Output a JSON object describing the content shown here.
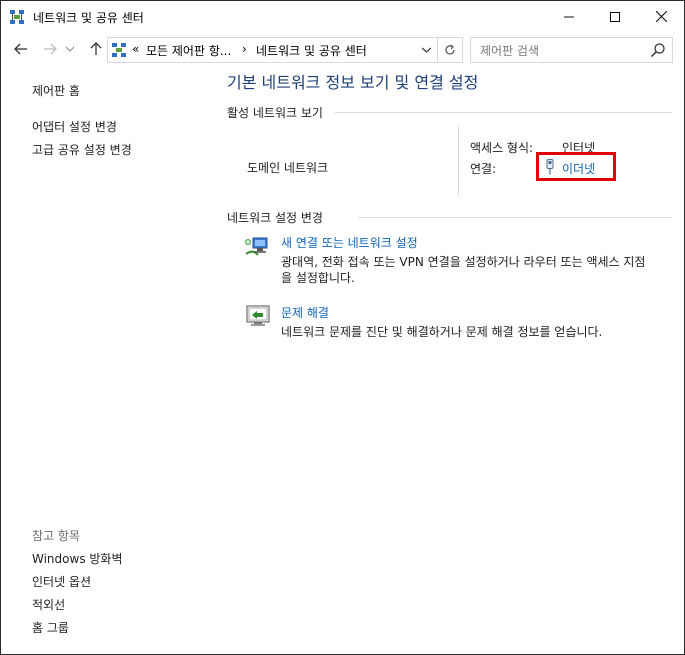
{
  "window": {
    "title": "네트워크 및 공유 센터"
  },
  "address": {
    "crumb_prefix": "«",
    "crumb_1": "모든 제어판 항...",
    "separator": "›",
    "crumb_2": "네트워크 및 공유 센터",
    "search_placeholder": "제어판 검색"
  },
  "sidebar": {
    "home": "제어판 홈",
    "items": [
      "어댑터 설정 변경",
      "고급 공유 설정 변경"
    ],
    "see_also_title": "참고 항목",
    "see_also": [
      "Windows 방화벽",
      "인터넷 옵션",
      "적외선",
      "홈 그룹"
    ]
  },
  "main": {
    "heading": "기본 네트워크 정보 보기 및 연결 설정",
    "active_section": "활성 네트워크 보기",
    "network_name": "도메인 네트워크",
    "access_type_label": "액세스 형식:",
    "access_type_value": "인터넷",
    "connection_label": "연결:",
    "connection_value": "이더넷",
    "change_section": "네트워크 설정 변경",
    "tasks": [
      {
        "title": "새 연결 또는 네트워크 설정",
        "desc_line1": "광대역, 전화 접속 또는 VPN 연결을 설정하거나 라우터 또는 액세스 지점",
        "desc_line2": "을 설정합니다.",
        "icon": "new-connection-icon"
      },
      {
        "title": "문제 해결",
        "desc_line1": "네트워크 문제를 진단 및 해결하거나 문제 해결 정보를 얻습니다.",
        "icon": "troubleshoot-icon"
      }
    ]
  },
  "colors": {
    "heading": "#1e3f76",
    "link": "#0d63b8",
    "highlight": "#e10000"
  }
}
